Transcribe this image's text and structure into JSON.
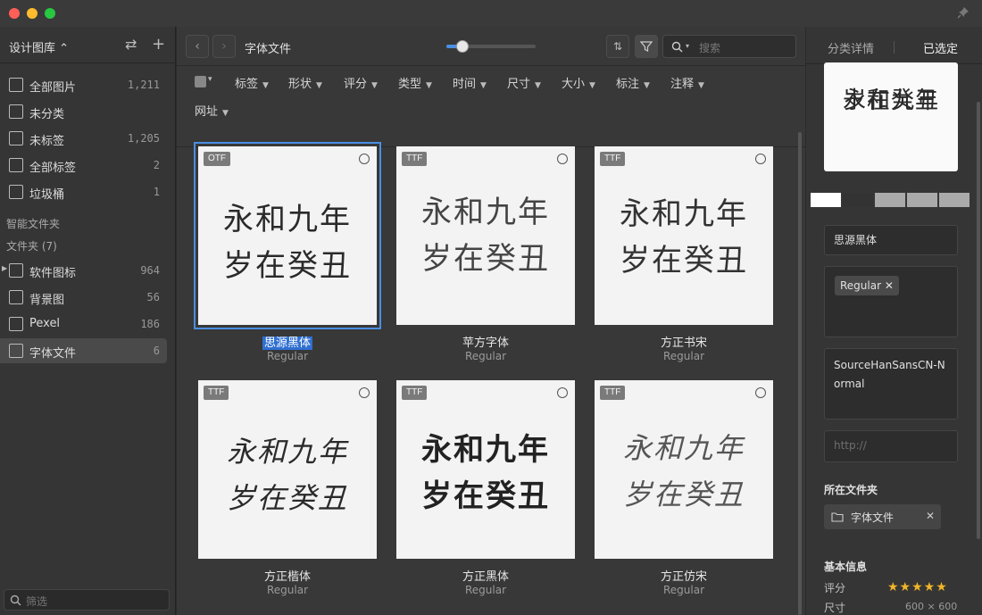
{
  "sidebar": {
    "library_title": "设计图库 ⌃",
    "items": [
      {
        "label": "全部图片",
        "count": "1,211"
      },
      {
        "label": "未分类",
        "count": ""
      },
      {
        "label": "未标签",
        "count": "1,205"
      },
      {
        "label": "全部标签",
        "count": "2"
      },
      {
        "label": "垃圾桶",
        "count": "1"
      }
    ],
    "smart_folders_label": "智能文件夹",
    "folders_label": "文件夹 (7)",
    "folders": [
      {
        "label": "软件图标",
        "count": "964"
      },
      {
        "label": "背景图",
        "count": "56"
      },
      {
        "label": "Pexel",
        "count": "186"
      },
      {
        "label": "字体文件",
        "count": "6"
      }
    ],
    "filter_placeholder": "筛选"
  },
  "toolbar": {
    "folder_title": "字体文件",
    "zoom_value": 0.18,
    "search_placeholder": "搜索"
  },
  "filters": {
    "row1": [
      "标签",
      "形状",
      "评分",
      "类型",
      "时间",
      "尺寸",
      "大小",
      "标注",
      "注释"
    ],
    "row2": [
      "网址"
    ]
  },
  "fonts": [
    {
      "badge": "OTF",
      "preview_line1": "永和九年",
      "preview_line2": "岁在癸丑",
      "name": "思源黑体",
      "style": "Regular"
    },
    {
      "badge": "TTF",
      "preview_line1": "永和九年",
      "preview_line2": "岁在癸丑",
      "name": "苹方字体",
      "style": "Regular"
    },
    {
      "badge": "TTF",
      "preview_line1": "永和九年",
      "preview_line2": "岁在癸丑",
      "name": "方正书宋",
      "style": "Regular"
    },
    {
      "badge": "TTF",
      "preview_line1": "永和九年",
      "preview_line2": "岁在癸丑",
      "name": "方正楷体",
      "style": "Regular"
    },
    {
      "badge": "TTF",
      "preview_line1": "永和九年",
      "preview_line2": "岁在癸丑",
      "name": "方正黑体",
      "style": "Regular"
    },
    {
      "badge": "TTF",
      "preview_line1": "永和九年",
      "preview_line2": "岁在癸丑",
      "name": "方正仿宋",
      "style": "Regular"
    }
  ],
  "right_panel": {
    "tab_details": "分类详情",
    "tab_selected": "已选定",
    "preview_line1": "永和九年",
    "preview_line2": "岁在癸丑",
    "palette": [
      "#ffffff",
      "#333333",
      "#aaaaaa",
      "#aaaaaa",
      "#aaaaaa"
    ],
    "name_value": "思源黑体",
    "tag": "Regular ✕",
    "annotation": "SourceHanSansCN-Normal",
    "url_placeholder": "http://",
    "folder_section_label": "所在文件夹",
    "folder_chip": "字体文件",
    "basic_info_label": "基本信息",
    "rating_label": "评分",
    "rating": 5,
    "stars": "★★★★★",
    "size_label": "尺寸",
    "size_value": "600 × 600"
  }
}
